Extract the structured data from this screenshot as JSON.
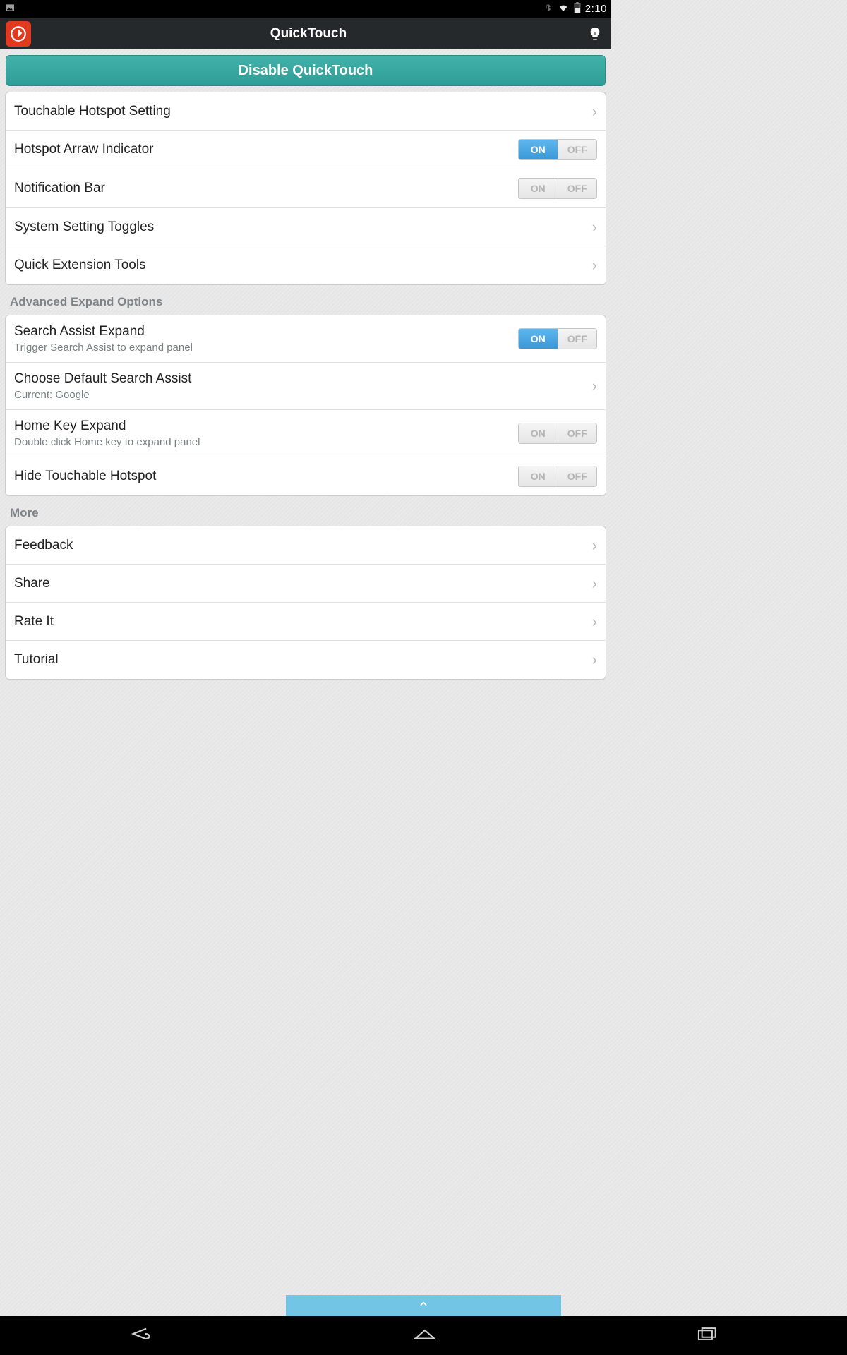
{
  "status": {
    "time": "2:10"
  },
  "header": {
    "title": "QuickTouch"
  },
  "disable_button": "Disable QuickTouch",
  "toggle_labels": {
    "on": "ON",
    "off": "OFF"
  },
  "section1": {
    "items": [
      {
        "title": "Touchable Hotspot Setting",
        "type": "nav"
      },
      {
        "title": "Hotspot Arraw Indicator",
        "type": "toggle",
        "state": "on"
      },
      {
        "title": "Notification Bar",
        "type": "toggle",
        "state": "off"
      },
      {
        "title": "System Setting Toggles",
        "type": "nav"
      },
      {
        "title": "Quick Extension Tools",
        "type": "nav"
      }
    ]
  },
  "section2": {
    "header": "Advanced Expand Options",
    "items": [
      {
        "title": "Search Assist Expand",
        "sub": "Trigger Search Assist to expand panel",
        "type": "toggle",
        "state": "on"
      },
      {
        "title": "Choose Default Search Assist",
        "sub": "Current: Google",
        "type": "nav"
      },
      {
        "title": "Home Key Expand",
        "sub": "Double click Home key to expand panel",
        "type": "toggle",
        "state": "off"
      },
      {
        "title": "Hide Touchable Hotspot",
        "type": "toggle",
        "state": "off"
      }
    ]
  },
  "section3": {
    "header": "More",
    "items": [
      {
        "title": "Feedback",
        "type": "nav"
      },
      {
        "title": "Share",
        "type": "nav"
      },
      {
        "title": "Rate It",
        "type": "nav"
      },
      {
        "title": "Tutorial",
        "type": "nav"
      }
    ]
  }
}
